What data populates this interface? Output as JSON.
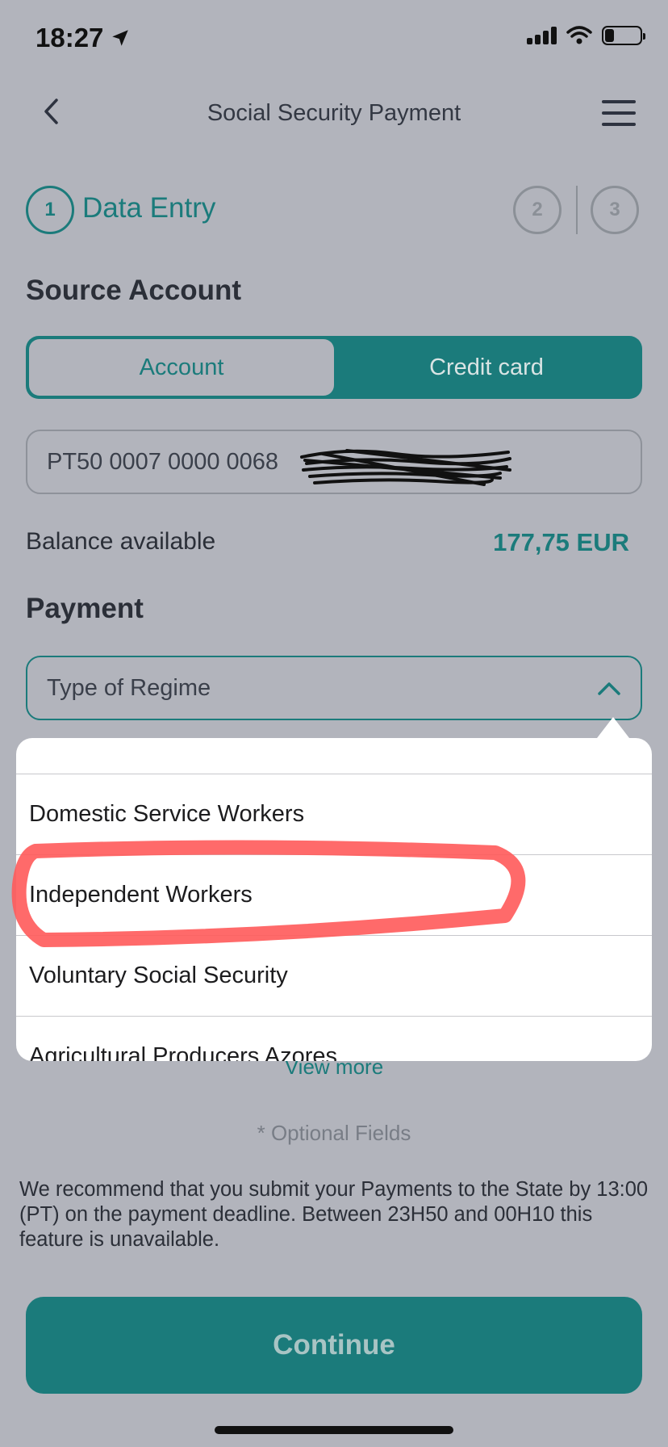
{
  "status_bar": {
    "time": "18:27"
  },
  "header": {
    "title": "Social Security Payment"
  },
  "stepper": {
    "steps": [
      {
        "number": "1",
        "label": "Data Entry"
      },
      {
        "number": "2"
      },
      {
        "number": "3"
      }
    ]
  },
  "source_account": {
    "title": "Source Account",
    "tabs": [
      "Account",
      "Credit card"
    ],
    "selected_tab": "Account",
    "account_number": "PT50 0007 0000 0068",
    "balance_label": "Balance available",
    "balance_value": "177,75 EUR"
  },
  "payment": {
    "title": "Payment",
    "regime_placeholder": "Type of Regime",
    "options": [
      "Domestic Service Workers",
      "Independent Workers",
      "Voluntary Social Security",
      "Agricultural Producers Azores"
    ],
    "view_more": "View more"
  },
  "optional_note": "* Optional Fields",
  "notice": "We recommend that you submit your Payments to the State by 13:00 (PT) on the payment deadline. Between 23H50 and 00H10 this feature is unavailable.",
  "continue_label": "Continue",
  "colors": {
    "accent": "#1b7b7b",
    "background": "#b2b4bc",
    "annotation": "#ff5a5a"
  }
}
